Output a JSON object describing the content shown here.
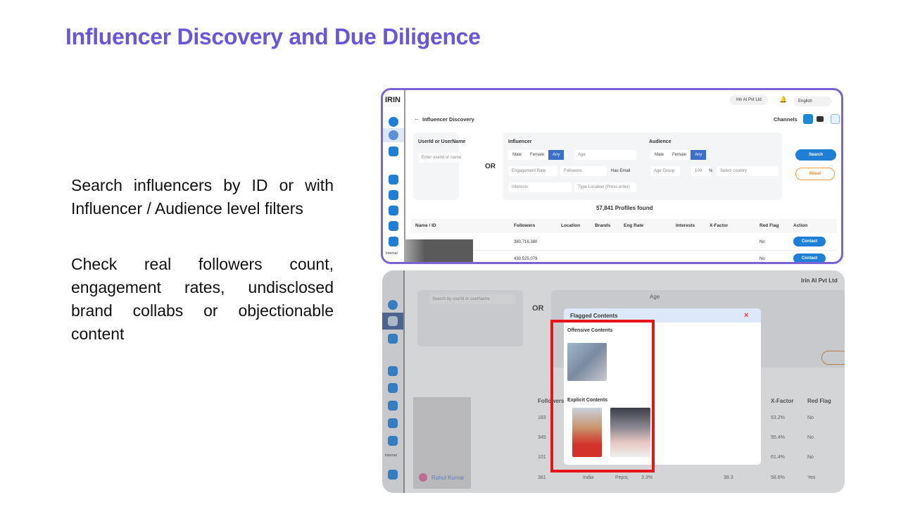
{
  "slide": {
    "title": "Influencer Discovery and Due Diligence",
    "point1": "Search influencers by ID or with Influencer / Audience level filters",
    "point2": "Check real followers count, engagement rates, undisclosed brand collabs or objectionable content"
  },
  "app": {
    "logo": "IRIN",
    "logo_sub": "SIMPLY AI",
    "org": "Irin AI Pvt Ltd",
    "language": "English",
    "page_title": "Influencer Discovery",
    "channels_label": "Channels",
    "sidebar_internal": "Internal",
    "userid_label": "UserId or UserName",
    "userid_placeholder": "Enter userid or name",
    "or": "OR",
    "influencer_label": "Influencer",
    "audience_label": "Audience",
    "gender": [
      "Male",
      "Female",
      "Any"
    ],
    "age": "Age",
    "engagement_rate": "Engagement Rate",
    "followers": "Followers",
    "has_email": "Has Email",
    "age_group": "Age Group",
    "age_pct": "100",
    "pct": "%",
    "country": "Select country",
    "interests": "Interests",
    "location_placeholder": "Type Location (Press enter)",
    "search": "Search",
    "reset": "Reset",
    "profiles_found": "57,841 Profiles found",
    "columns": [
      "Name / ID",
      "Followers",
      "Location",
      "Brands",
      "Eng Rate",
      "Interests",
      "X-Factor",
      "Red Flag",
      "Action"
    ],
    "rows": [
      {
        "followers": "380,716,380",
        "red_flag": "No",
        "action": "Contact"
      },
      {
        "followers": "430,525,079",
        "red_flag": "No",
        "action": "Contact"
      }
    ]
  },
  "app2": {
    "org": "Irin AI Pvt Ltd",
    "search_placeholder": "Search by userId or userName",
    "or": "OR",
    "age": "Age",
    "age_group": "e Group",
    "age_pct": "0",
    "pct": "%",
    "col_followers": "Followers",
    "col_xfactor": "X-Factor",
    "col_redflag": "Red Flag",
    "sidebar_internal": "Internal",
    "rows": [
      {
        "followers": "183",
        "xfactor": "53.2%",
        "red_flag": "No"
      },
      {
        "followers": "345",
        "xfactor": "55.4%",
        "red_flag": "No"
      },
      {
        "followers": "101",
        "xfactor": "61.4%",
        "red_flag": "No"
      },
      {
        "name": "Rahul Kumar",
        "followers": "381",
        "location": "India",
        "brands": "Pepsi,",
        "eng": "3.3%",
        "interests": "38.3",
        "xfactor": "58.6%",
        "red_flag": "Yes"
      }
    ],
    "modal": {
      "title": "Flagged Contents",
      "close": "×",
      "offensive": "Offensive Contents",
      "explicit": "Explicit Contents"
    },
    "highlight_color": "#e8141b"
  }
}
